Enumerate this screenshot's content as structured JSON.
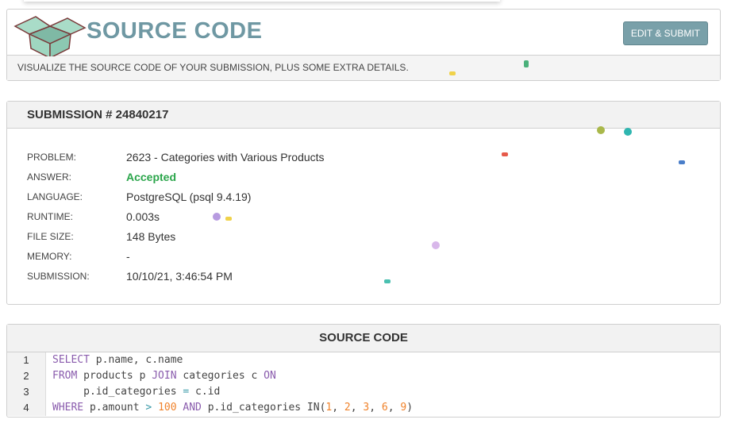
{
  "header": {
    "title": "SOURCE CODE",
    "edit_submit_label": "EDIT & SUBMIT",
    "subtitle": "VISUALIZE THE SOURCE CODE OF YOUR SUBMISSION, PLUS SOME EXTRA DETAILS.",
    "logo_icon": "open-box-icon"
  },
  "submission": {
    "title": "SUBMISSION # 24840217",
    "details": [
      {
        "label": "PROBLEM:",
        "value": "2623 - Categories with Various Products"
      },
      {
        "label": "ANSWER:",
        "value": "Accepted"
      },
      {
        "label": "LANGUAGE:",
        "value": "PostgreSQL (psql 9.4.19)"
      },
      {
        "label": "RUNTIME:",
        "value": "0.003s"
      },
      {
        "label": "FILE SIZE:",
        "value": "148 Bytes"
      },
      {
        "label": "MEMORY:",
        "value": "-"
      },
      {
        "label": "SUBMISSION:",
        "value": "10/10/21, 3:46:54 PM"
      }
    ],
    "accepted_color": "#2aa54a"
  },
  "source": {
    "title": "SOURCE CODE",
    "lines": [
      {
        "n": "1",
        "tokens": [
          {
            "t": "SELECT",
            "c": "kw"
          },
          {
            "t": " p.name, c.name",
            "c": ""
          }
        ]
      },
      {
        "n": "2",
        "tokens": [
          {
            "t": "FROM",
            "c": "kw"
          },
          {
            "t": " products p ",
            "c": ""
          },
          {
            "t": "JOIN",
            "c": "kw"
          },
          {
            "t": " categories c ",
            "c": ""
          },
          {
            "t": "ON",
            "c": "kw"
          }
        ]
      },
      {
        "n": "3",
        "tokens": [
          {
            "t": "     p.id_categories ",
            "c": ""
          },
          {
            "t": "=",
            "c": "op"
          },
          {
            "t": " c.id",
            "c": ""
          }
        ]
      },
      {
        "n": "4",
        "tokens": [
          {
            "t": "WHERE",
            "c": "kw"
          },
          {
            "t": " p.amount ",
            "c": ""
          },
          {
            "t": ">",
            "c": "op"
          },
          {
            "t": " ",
            "c": ""
          },
          {
            "t": "100",
            "c": "num"
          },
          {
            "t": " ",
            "c": ""
          },
          {
            "t": "AND",
            "c": "kw"
          },
          {
            "t": " p.id_categories IN(",
            "c": ""
          },
          {
            "t": "1",
            "c": "num"
          },
          {
            "t": ", ",
            "c": ""
          },
          {
            "t": "2",
            "c": "num"
          },
          {
            "t": ", ",
            "c": ""
          },
          {
            "t": "3",
            "c": "num"
          },
          {
            "t": ", ",
            "c": ""
          },
          {
            "t": "6",
            "c": "num"
          },
          {
            "t": ", ",
            "c": ""
          },
          {
            "t": "9",
            "c": "num"
          },
          {
            "t": ")",
            "c": ""
          }
        ]
      }
    ]
  }
}
